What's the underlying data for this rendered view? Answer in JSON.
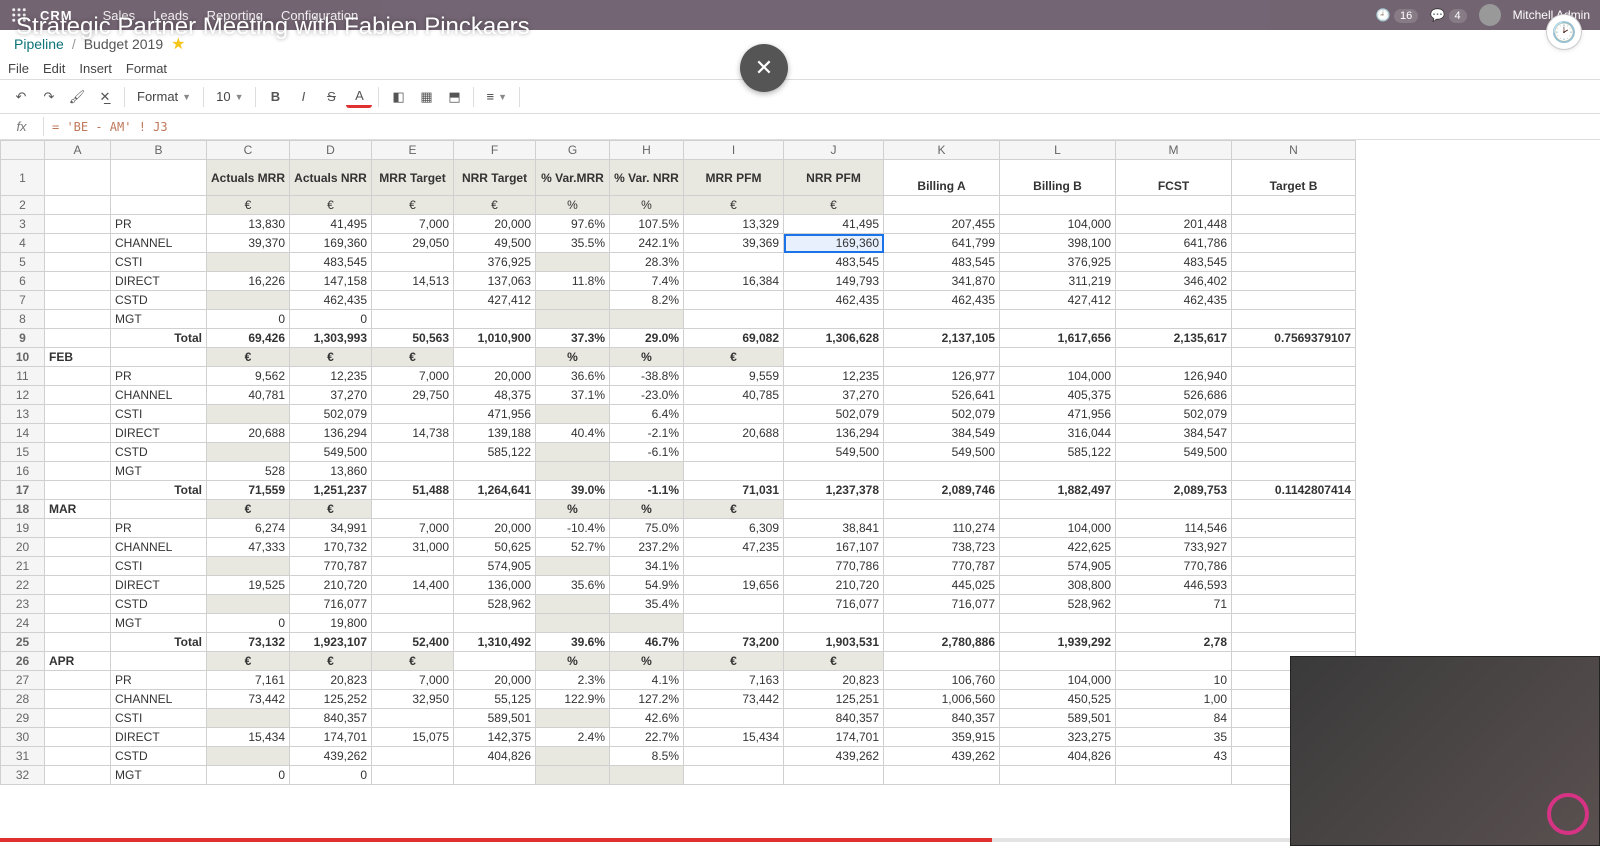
{
  "video_overlay": {
    "title": "Strategic Partner Meeting with Fabien Pinckaers"
  },
  "topbar": {
    "brand": "CRM",
    "nav": [
      "Sales",
      "Leads",
      "Reporting",
      "Configuration"
    ],
    "clock_badge": "16",
    "chat_badge": "4",
    "user": "Mitchell Admin"
  },
  "breadcrumbs": {
    "root": "Pipeline",
    "current": "Budget 2019"
  },
  "filemenu": [
    "File",
    "Edit",
    "Insert",
    "Format"
  ],
  "toolbar": {
    "format_label": "Format",
    "font_size": "10"
  },
  "fx": {
    "formula": "= 'BE - AM' ! J3"
  },
  "columns": [
    "",
    "A",
    "B",
    "C",
    "D",
    "E",
    "F",
    "G",
    "H",
    "I",
    "J",
    "K",
    "L",
    "M",
    "N"
  ],
  "header_row": {
    "C": "Actuals MRR",
    "D": "Actuals NRR",
    "E": "MRR Target",
    "F": "NRR Target",
    "G": "% Var.MRR",
    "H": "% Var. NRR",
    "I": "MRR PFM",
    "J": "NRR PFM",
    "K": "Billing A",
    "L": "Billing B",
    "M": "FCST",
    "N": "Target B"
  },
  "rows": [
    {
      "n": 1,
      "type": "hdr"
    },
    {
      "n": 2,
      "type": "unit",
      "C": "€",
      "D": "€",
      "E": "€",
      "F": "€",
      "G": "%",
      "H": "%",
      "I": "€",
      "J": "€"
    },
    {
      "n": 3,
      "type": "data",
      "B": "PR",
      "C": "13,830",
      "D": "41,495",
      "E": "7,000",
      "F": "20,000",
      "G": "97.6%",
      "H": "107.5%",
      "I": "13,329",
      "J": "41,495",
      "K": "207,455",
      "L": "104,000",
      "M": "201,448"
    },
    {
      "n": 4,
      "type": "data",
      "B": "CHANNEL",
      "C": "39,370",
      "D": "169,360",
      "E": "29,050",
      "F": "49,500",
      "G": "35.5%",
      "H": "242.1%",
      "I": "39,369",
      "J": "169,360",
      "K": "641,799",
      "L": "398,100",
      "M": "641,786",
      "sel": "J"
    },
    {
      "n": 5,
      "type": "data",
      "B": "CSTI",
      "C": "",
      "D": "483,545",
      "E": "",
      "F": "376,925",
      "G": "",
      "H": "28.3%",
      "I": "",
      "J": "483,545",
      "K": "483,545",
      "L": "376,925",
      "M": "483,545"
    },
    {
      "n": 6,
      "type": "data",
      "B": "DIRECT",
      "C": "16,226",
      "D": "147,158",
      "E": "14,513",
      "F": "137,063",
      "G": "11.8%",
      "H": "7.4%",
      "I": "16,384",
      "J": "149,793",
      "K": "341,870",
      "L": "311,219",
      "M": "346,402"
    },
    {
      "n": 7,
      "type": "data",
      "B": "CSTD",
      "C": "",
      "D": "462,435",
      "E": "",
      "F": "427,412",
      "G": "",
      "H": "8.2%",
      "I": "",
      "J": "462,435",
      "K": "462,435",
      "L": "427,412",
      "M": "462,435"
    },
    {
      "n": 8,
      "type": "data",
      "B": "MGT",
      "C": "0",
      "D": "0"
    },
    {
      "n": 9,
      "type": "total",
      "B": "Total",
      "C": "69,426",
      "D": "1,303,993",
      "E": "50,563",
      "F": "1,010,900",
      "G": "37.3%",
      "H": "29.0%",
      "I": "69,082",
      "J": "1,306,628",
      "K": "2,137,105",
      "L": "1,617,656",
      "M": "2,135,617",
      "N": "0.7569379107"
    },
    {
      "n": 10,
      "type": "month",
      "A": "FEB",
      "C": "€",
      "D": "€",
      "E": "€",
      "F": "",
      "G": "%",
      "H": "%",
      "I": "€",
      "J": ""
    },
    {
      "n": 11,
      "type": "data",
      "B": "PR",
      "C": "9,562",
      "D": "12,235",
      "E": "7,000",
      "F": "20,000",
      "G": "36.6%",
      "H": "-38.8%",
      "I": "9,559",
      "J": "12,235",
      "K": "126,977",
      "L": "104,000",
      "M": "126,940"
    },
    {
      "n": 12,
      "type": "data",
      "B": "CHANNEL",
      "C": "40,781",
      "D": "37,270",
      "E": "29,750",
      "F": "48,375",
      "G": "37.1%",
      "H": "-23.0%",
      "I": "40,785",
      "J": "37,270",
      "K": "526,641",
      "L": "405,375",
      "M": "526,686"
    },
    {
      "n": 13,
      "type": "data",
      "B": "CSTI",
      "C": "",
      "D": "502,079",
      "E": "",
      "F": "471,956",
      "G": "",
      "H": "6.4%",
      "I": "",
      "J": "502,079",
      "K": "502,079",
      "L": "471,956",
      "M": "502,079"
    },
    {
      "n": 14,
      "type": "data",
      "B": "DIRECT",
      "C": "20,688",
      "D": "136,294",
      "E": "14,738",
      "F": "139,188",
      "G": "40.4%",
      "H": "-2.1%",
      "I": "20,688",
      "J": "136,294",
      "K": "384,549",
      "L": "316,044",
      "M": "384,547"
    },
    {
      "n": 15,
      "type": "data",
      "B": "CSTD",
      "C": "",
      "D": "549,500",
      "E": "",
      "F": "585,122",
      "G": "",
      "H": "-6.1%",
      "I": "",
      "J": "549,500",
      "K": "549,500",
      "L": "585,122",
      "M": "549,500"
    },
    {
      "n": 16,
      "type": "data",
      "B": "MGT",
      "C": "528",
      "D": "13,860"
    },
    {
      "n": 17,
      "type": "total",
      "B": "Total",
      "C": "71,559",
      "D": "1,251,237",
      "E": "51,488",
      "F": "1,264,641",
      "G": "39.0%",
      "H": "-1.1%",
      "I": "71,031",
      "J": "1,237,378",
      "K": "2,089,746",
      "L": "1,882,497",
      "M": "2,089,753",
      "N": "0.1142807414"
    },
    {
      "n": 18,
      "type": "month",
      "A": "MAR",
      "C": "€",
      "D": "€",
      "E": "",
      "F": "",
      "G": "%",
      "H": "%",
      "I": "€",
      "J": ""
    },
    {
      "n": 19,
      "type": "data",
      "B": "PR",
      "C": "6,274",
      "D": "34,991",
      "E": "7,000",
      "F": "20,000",
      "G": "-10.4%",
      "H": "75.0%",
      "I": "6,309",
      "J": "38,841",
      "K": "110,274",
      "L": "104,000",
      "M": "114,546"
    },
    {
      "n": 20,
      "type": "data",
      "B": "CHANNEL",
      "C": "47,333",
      "D": "170,732",
      "E": "31,000",
      "F": "50,625",
      "G": "52.7%",
      "H": "237.2%",
      "I": "47,235",
      "J": "167,107",
      "K": "738,723",
      "L": "422,625",
      "M": "733,927"
    },
    {
      "n": 21,
      "type": "data",
      "B": "CSTI",
      "C": "",
      "D": "770,787",
      "E": "",
      "F": "574,905",
      "G": "",
      "H": "34.1%",
      "I": "",
      "J": "770,786",
      "K": "770,787",
      "L": "574,905",
      "M": "770,786"
    },
    {
      "n": 22,
      "type": "data",
      "B": "DIRECT",
      "C": "19,525",
      "D": "210,720",
      "E": "14,400",
      "F": "136,000",
      "G": "35.6%",
      "H": "54.9%",
      "I": "19,656",
      "J": "210,720",
      "K": "445,025",
      "L": "308,800",
      "M": "446,593"
    },
    {
      "n": 23,
      "type": "data",
      "B": "CSTD",
      "C": "",
      "D": "716,077",
      "E": "",
      "F": "528,962",
      "G": "",
      "H": "35.4%",
      "I": "",
      "J": "716,077",
      "K": "716,077",
      "L": "528,962",
      "M": "71"
    },
    {
      "n": 24,
      "type": "data",
      "B": "MGT",
      "C": "0",
      "D": "19,800"
    },
    {
      "n": 25,
      "type": "total",
      "B": "Total",
      "C": "73,132",
      "D": "1,923,107",
      "E": "52,400",
      "F": "1,310,492",
      "G": "39.6%",
      "H": "46.7%",
      "I": "73,200",
      "J": "1,903,531",
      "K": "2,780,886",
      "L": "1,939,292",
      "M": "2,78"
    },
    {
      "n": 26,
      "type": "month",
      "A": "APR",
      "C": "€",
      "D": "€",
      "E": "€",
      "F": "",
      "G": "%",
      "H": "%",
      "I": "€",
      "J": "€"
    },
    {
      "n": 27,
      "type": "data",
      "B": "PR",
      "C": "7,161",
      "D": "20,823",
      "E": "7,000",
      "F": "20,000",
      "G": "2.3%",
      "H": "4.1%",
      "I": "7,163",
      "J": "20,823",
      "K": "106,760",
      "L": "104,000",
      "M": "10"
    },
    {
      "n": 28,
      "type": "data",
      "B": "CHANNEL",
      "C": "73,442",
      "D": "125,252",
      "E": "32,950",
      "F": "55,125",
      "G": "122.9%",
      "H": "127.2%",
      "I": "73,442",
      "J": "125,251",
      "K": "1,006,560",
      "L": "450,525",
      "M": "1,00"
    },
    {
      "n": 29,
      "type": "data",
      "B": "CSTI",
      "C": "",
      "D": "840,357",
      "E": "",
      "F": "589,501",
      "G": "",
      "H": "42.6%",
      "I": "",
      "J": "840,357",
      "K": "840,357",
      "L": "589,501",
      "M": "84"
    },
    {
      "n": 30,
      "type": "data",
      "B": "DIRECT",
      "C": "15,434",
      "D": "174,701",
      "E": "15,075",
      "F": "142,375",
      "G": "2.4%",
      "H": "22.7%",
      "I": "15,434",
      "J": "174,701",
      "K": "359,915",
      "L": "323,275",
      "M": "35"
    },
    {
      "n": 31,
      "type": "data",
      "B": "CSTD",
      "C": "",
      "D": "439,262",
      "E": "",
      "F": "404,826",
      "G": "",
      "H": "8.5%",
      "I": "",
      "J": "439,262",
      "K": "439,262",
      "L": "404,826",
      "M": "43"
    },
    {
      "n": 32,
      "type": "data",
      "B": "MGT",
      "C": "0",
      "D": "0"
    }
  ]
}
